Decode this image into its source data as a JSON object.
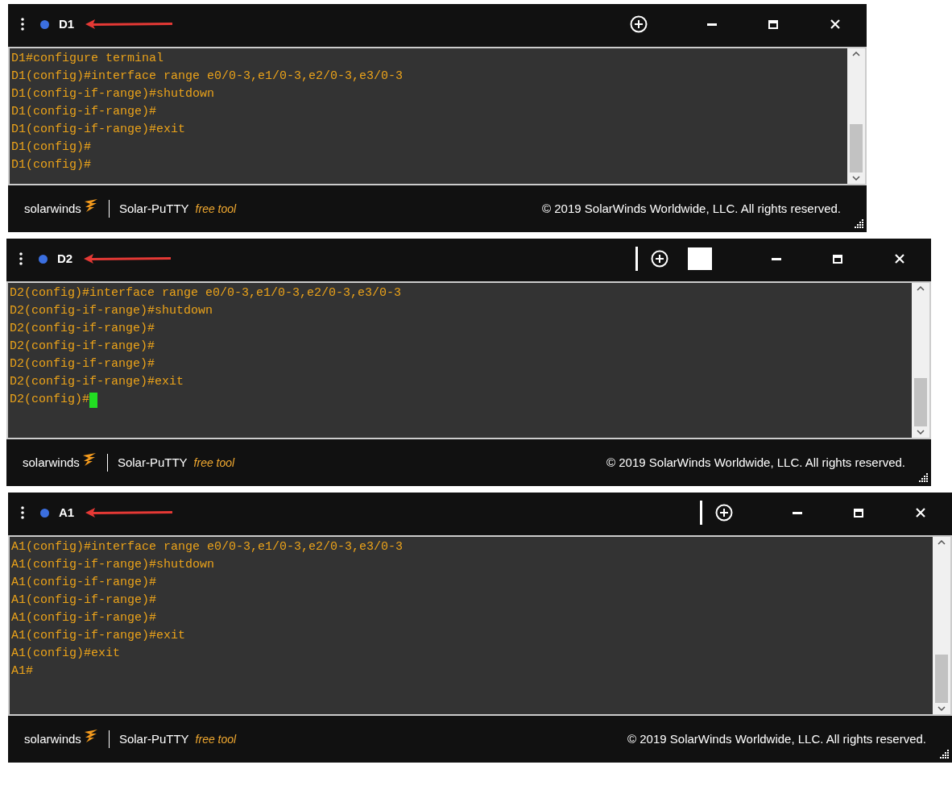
{
  "windows": [
    {
      "title": "D1",
      "divider": false,
      "white_block": false,
      "cursor": false,
      "lines": [
        "D1#configure terminal",
        "D1(config)#interface range e0/0-3,e1/0-3,e2/0-3,e3/0-3",
        "D1(config-if-range)#shutdown",
        "D1(config-if-range)#",
        "D1(config-if-range)#exit",
        "D1(config)#",
        "D1(config)#"
      ],
      "footer": {
        "brand": "solarwinds",
        "product": "Solar-PuTTY",
        "tag": "free tool",
        "copyright": "© 2019 SolarWinds Worldwide, LLC. All rights reserved."
      }
    },
    {
      "title": "D2",
      "divider": true,
      "white_block": true,
      "cursor": true,
      "lines": [
        "D2(config)#interface range e0/0-3,e1/0-3,e2/0-3,e3/0-3",
        "D2(config-if-range)#shutdown",
        "D2(config-if-range)#",
        "D2(config-if-range)#",
        "D2(config-if-range)#",
        "D2(config-if-range)#exit",
        "D2(config)#"
      ],
      "footer": {
        "brand": "solarwinds",
        "product": "Solar-PuTTY",
        "tag": "free tool",
        "copyright": "© 2019 SolarWinds Worldwide, LLC. All rights reserved."
      }
    },
    {
      "title": "A1",
      "divider": true,
      "white_block": false,
      "cursor": false,
      "lines": [
        "A1(config)#interface range e0/0-3,e1/0-3,e2/0-3,e3/0-3",
        "A1(config-if-range)#shutdown",
        "A1(config-if-range)#",
        "A1(config-if-range)#",
        "A1(config-if-range)#",
        "A1(config-if-range)#exit",
        "A1(config)#exit",
        "A1#"
      ],
      "footer": {
        "brand": "solarwinds",
        "product": "Solar-PuTTY",
        "tag": "free tool",
        "copyright": "© 2019 SolarWinds Worldwide, LLC. All rights reserved."
      }
    }
  ]
}
